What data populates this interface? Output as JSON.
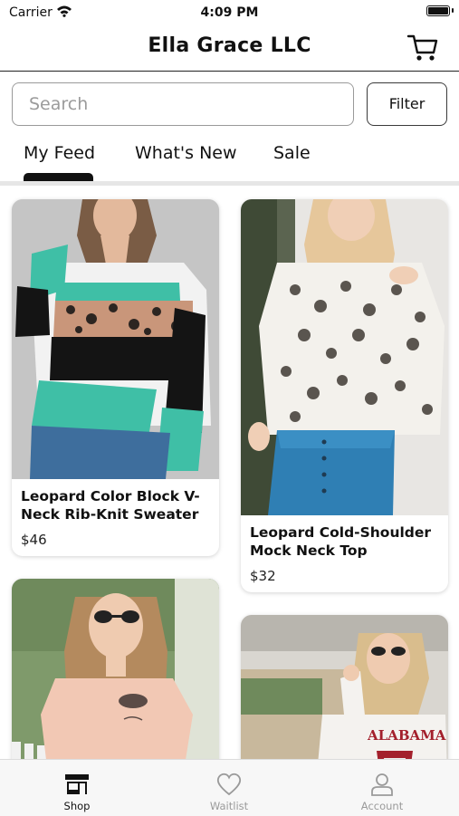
{
  "status_bar": {
    "carrier": "Carrier",
    "time": "4:09 PM"
  },
  "header": {
    "title": "Ella Grace LLC",
    "cart_icon": "shopping-cart-icon"
  },
  "search": {
    "placeholder": "Search",
    "filter_label": "Filter"
  },
  "tabs": [
    {
      "label": "My Feed",
      "active": true
    },
    {
      "label": "What's New",
      "active": false
    },
    {
      "label": "Sale",
      "active": false
    }
  ],
  "products": [
    {
      "name": "Leopard Color Block V-Neck Rib-Knit Sweater",
      "price": "$46"
    },
    {
      "name": "Leopard Cold-Shoulder Mock Neck Top",
      "price": "$32"
    },
    {
      "name": "",
      "price": ""
    },
    {
      "name": "",
      "price": ""
    }
  ],
  "bottom_nav": [
    {
      "label": "Shop",
      "icon": "storefront-icon",
      "active": true
    },
    {
      "label": "Waitlist",
      "icon": "heart-icon",
      "active": false
    },
    {
      "label": "Account",
      "icon": "person-icon",
      "active": false
    }
  ],
  "colors": {
    "accent": "#111111",
    "inactive": "#9a9a9a",
    "tab_track": "#e6e6e6"
  }
}
